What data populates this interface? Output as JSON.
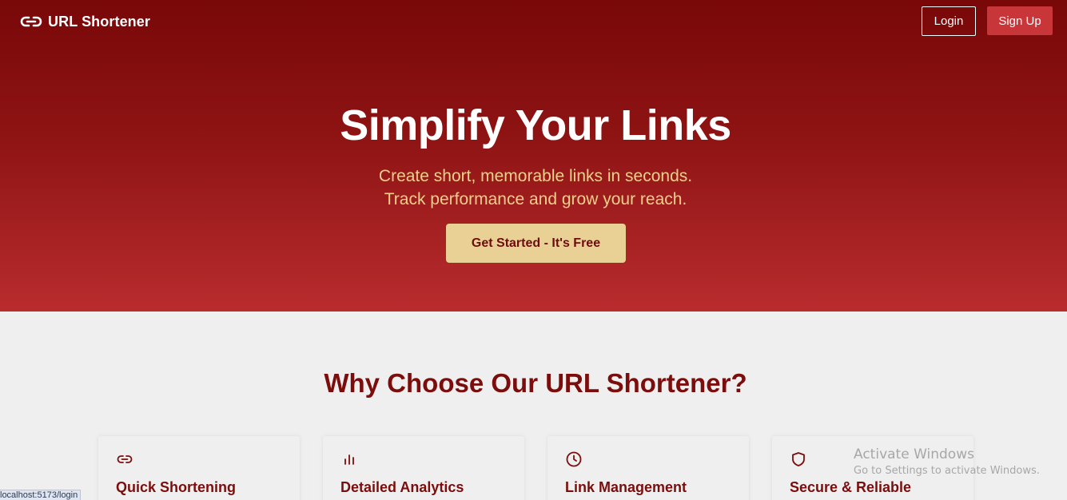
{
  "nav": {
    "brand": "URL Shortener",
    "brand_icon": "link-icon",
    "login_label": "Login",
    "signup_label": "Sign Up"
  },
  "hero": {
    "title": "Simplify Your Links",
    "subtitle_line1": "Create short, memorable links in seconds.",
    "subtitle_line2": "Track performance and grow your reach.",
    "cta_label": "Get Started - It's Free"
  },
  "features": {
    "heading": "Why Choose Our URL Shortener?",
    "cards": [
      {
        "title": "Quick Shortening",
        "icon": "link-icon"
      },
      {
        "title": "Detailed Analytics",
        "icon": "bar-chart-icon"
      },
      {
        "title": "Link Management",
        "icon": "clock-icon"
      },
      {
        "title": "Secure & Reliable",
        "icon": "shield-icon"
      }
    ]
  },
  "status_bar": {
    "link_preview": "localhost:5173/login"
  },
  "watermark": {
    "title": "Activate Windows",
    "subtitle": "Go to Settings to activate Windows."
  },
  "colors": {
    "hero_top": "#790808",
    "hero_bottom": "#b92c2e",
    "accent_gold": "#e9d196",
    "subtitle_gold": "#f2cf8c",
    "heading_red": "#7b0d0d",
    "signup_red": "#c8363a",
    "page_bg": "#efefef"
  }
}
